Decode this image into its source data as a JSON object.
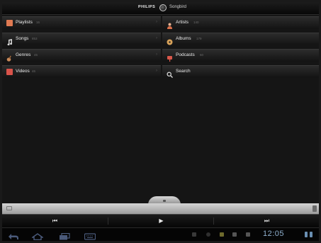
{
  "header": {
    "brand": "PHILIPS",
    "app_name": "Songbird"
  },
  "menu": {
    "left": [
      {
        "label": "Playlists",
        "count": "16",
        "icon": "playlist-icon",
        "icon_color": "#e07a52"
      },
      {
        "label": "Songs",
        "count": "853",
        "icon": "music-note-icon",
        "icon_color": "#d8d8d8"
      },
      {
        "label": "Genres",
        "count": "45",
        "icon": "guitar-icon",
        "icon_color": "#c98a5a"
      },
      {
        "label": "Videos",
        "count": "46",
        "icon": "video-icon",
        "icon_color": "#d9534a"
      }
    ],
    "right": [
      {
        "label": "Artists",
        "count": "140",
        "icon": "person-icon",
        "icon_color": "#d96f4a"
      },
      {
        "label": "Albums",
        "count": "179",
        "icon": "disc-icon",
        "icon_color": "#d9a35a"
      },
      {
        "label": "Podcasts",
        "count": "60",
        "icon": "podcast-icon",
        "icon_color": "#d9574a"
      },
      {
        "label": "Search",
        "count": "",
        "icon": "search-icon",
        "icon_color": "#e0e0e0"
      }
    ]
  },
  "playback": {
    "prev": "⏮",
    "play": "▶",
    "next": "⏭"
  },
  "status_bar": {
    "time": "12:05"
  },
  "colors": {
    "accent_clock": "#8fb0cf",
    "background": "#151515"
  }
}
